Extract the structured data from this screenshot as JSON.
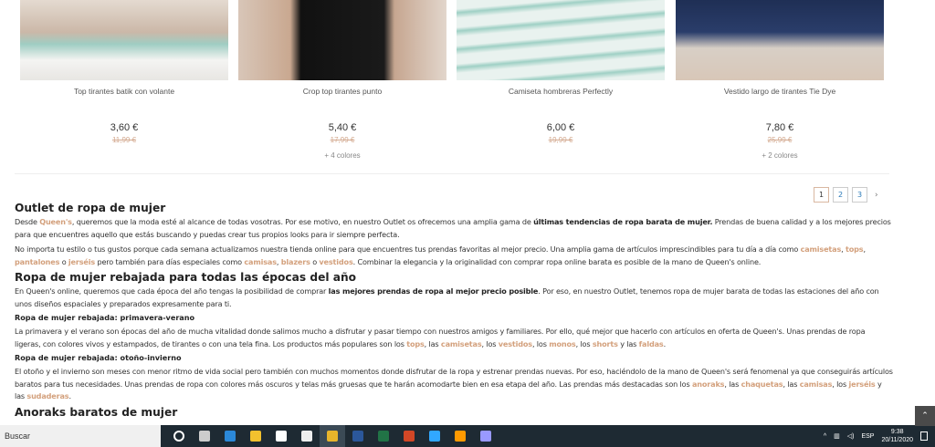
{
  "products": [
    {
      "name": "Top tirantes batik con volante",
      "price": "3,60 €",
      "old_price": "11,99 €",
      "colors": ""
    },
    {
      "name": "Crop top tirantes punto",
      "price": "5,40 €",
      "old_price": "17,99 €",
      "colors": "+ 4 colores"
    },
    {
      "name": "Camiseta hombreras Perfectly",
      "price": "6,00 €",
      "old_price": "19,99 €",
      "colors": ""
    },
    {
      "name": "Vestido largo de tirantes Tie Dye",
      "price": "7,80 €",
      "old_price": "25,99 €",
      "colors": "+ 2 colores"
    }
  ],
  "pagination": {
    "pages": [
      "1",
      "2",
      "3"
    ],
    "current": "1",
    "next": "›"
  },
  "content": {
    "h1": "Outlet de ropa de mujer",
    "p1": [
      [
        "Desde ",
        ""
      ],
      [
        "Queen's",
        "l"
      ],
      [
        ", queremos que la moda esté al alcance de todas vosotras. Por ese motivo, en nuestro Outlet os ofrecemos una amplia gama de ",
        ""
      ],
      [
        "últimas tendencias de ropa barata de mujer.",
        "b"
      ],
      [
        " Prendas de buena calidad y a los mejores precios para que encuentres aquello que estás buscando y puedas crear tus propios looks para ir siempre perfecta.",
        ""
      ]
    ],
    "p2": [
      [
        "No importa tu estilo o tus gustos porque cada semana actualizamos nuestra tienda online para que encuentres tus prendas favoritas al mejor precio. Una amplia gama de artículos imprescindibles para tu día a día como ",
        ""
      ],
      [
        "camisetas",
        "l"
      ],
      [
        ", ",
        ""
      ],
      [
        "tops",
        "l"
      ],
      [
        ", ",
        ""
      ],
      [
        "pantalones",
        "l"
      ],
      [
        " o ",
        ""
      ],
      [
        "jerséis",
        "l"
      ],
      [
        " pero también para días especiales como ",
        ""
      ],
      [
        "camisas",
        "l"
      ],
      [
        ", ",
        ""
      ],
      [
        "blazers",
        "l"
      ],
      [
        " o ",
        ""
      ],
      [
        "vestidos",
        "l"
      ],
      [
        ". Combinar la elegancia y la originalidad con comprar ropa online barata es posible de la mano de Queen's online.",
        ""
      ]
    ],
    "h2": "Ropa de mujer rebajada para todas las épocas del año",
    "p3": [
      [
        "En Queen's online, queremos que cada época del año tengas la posibilidad de comprar ",
        ""
      ],
      [
        "las mejores prendas de ropa al mejor precio posible",
        "b"
      ],
      [
        ". Por eso, en nuestro Outlet, tenemos ropa de mujer barata de todas las estaciones del año con unos diseños espaciales y preparados expresamente para ti.",
        ""
      ]
    ],
    "h3": "Ropa de mujer rebajada: primavera-verano",
    "p4": [
      [
        "La primavera y el verano son épocas del año de mucha vitalidad donde salimos mucho a disfrutar y pasar tiempo con nuestros amigos y familiares. Por ello, qué mejor que hacerlo con artículos en oferta de Queen's. Unas prendas de ropa ligeras, con colores vivos y estampados, de tirantes o con una tela fina. Los productos más populares son los ",
        ""
      ],
      [
        "tops",
        "l"
      ],
      [
        ", las ",
        ""
      ],
      [
        "camisetas",
        "l"
      ],
      [
        ", los ",
        ""
      ],
      [
        "vestidos",
        "l"
      ],
      [
        ", los ",
        ""
      ],
      [
        "monos",
        "l"
      ],
      [
        ", los ",
        ""
      ],
      [
        "shorts",
        "l"
      ],
      [
        " y las ",
        ""
      ],
      [
        "faldas",
        "l"
      ],
      [
        ".",
        ""
      ]
    ],
    "h4": "Ropa de mujer rebajada: otoño-invierno",
    "p5": [
      [
        "El otoño y el invierno son meses con menor ritmo de vida social pero también con muchos momentos donde disfrutar de la ropa y estrenar prendas nuevas. Por eso, haciéndolo de la mano de Queen's será fenomenal ya que conseguirás artículos baratos para tus necesidades. Unas prendas de ropa con colores más oscuros y telas más gruesas que te harán acomodarte bien en esa etapa del año. Las prendas más destacadas son los ",
        ""
      ],
      [
        "anoraks",
        "l"
      ],
      [
        ", las ",
        ""
      ],
      [
        "chaquetas",
        "l"
      ],
      [
        ", las ",
        ""
      ],
      [
        "camisas",
        "l"
      ],
      [
        ", los ",
        ""
      ],
      [
        "jerséis",
        "l"
      ],
      [
        " y las ",
        ""
      ],
      [
        "sudaderas",
        "l"
      ],
      [
        ".",
        ""
      ]
    ],
    "h5": "Anoraks baratos de mujer"
  },
  "taskbar": {
    "search": "Buscar",
    "lang": "ESP",
    "time": "9:38",
    "date": "20/11/2020",
    "apps": [
      {
        "name": "cortana-icon",
        "color": "#ffffff"
      },
      {
        "name": "task-view-icon",
        "color": "#cccccc"
      },
      {
        "name": "edge-icon",
        "color": "#2b88d8"
      },
      {
        "name": "file-explorer-icon",
        "color": "#f2c12e"
      },
      {
        "name": "store-icon",
        "color": "#ffffff"
      },
      {
        "name": "mail-icon",
        "color": "#eeeeee"
      },
      {
        "name": "chrome-icon",
        "color": "#e8b52b"
      },
      {
        "name": "word-icon",
        "color": "#2b579a"
      },
      {
        "name": "excel-icon",
        "color": "#217346"
      },
      {
        "name": "powerpoint-icon",
        "color": "#d24726"
      },
      {
        "name": "photoshop-icon",
        "color": "#31a8ff"
      },
      {
        "name": "illustrator-icon",
        "color": "#ff9a00"
      },
      {
        "name": "after-effects-icon",
        "color": "#9999ff"
      }
    ]
  }
}
